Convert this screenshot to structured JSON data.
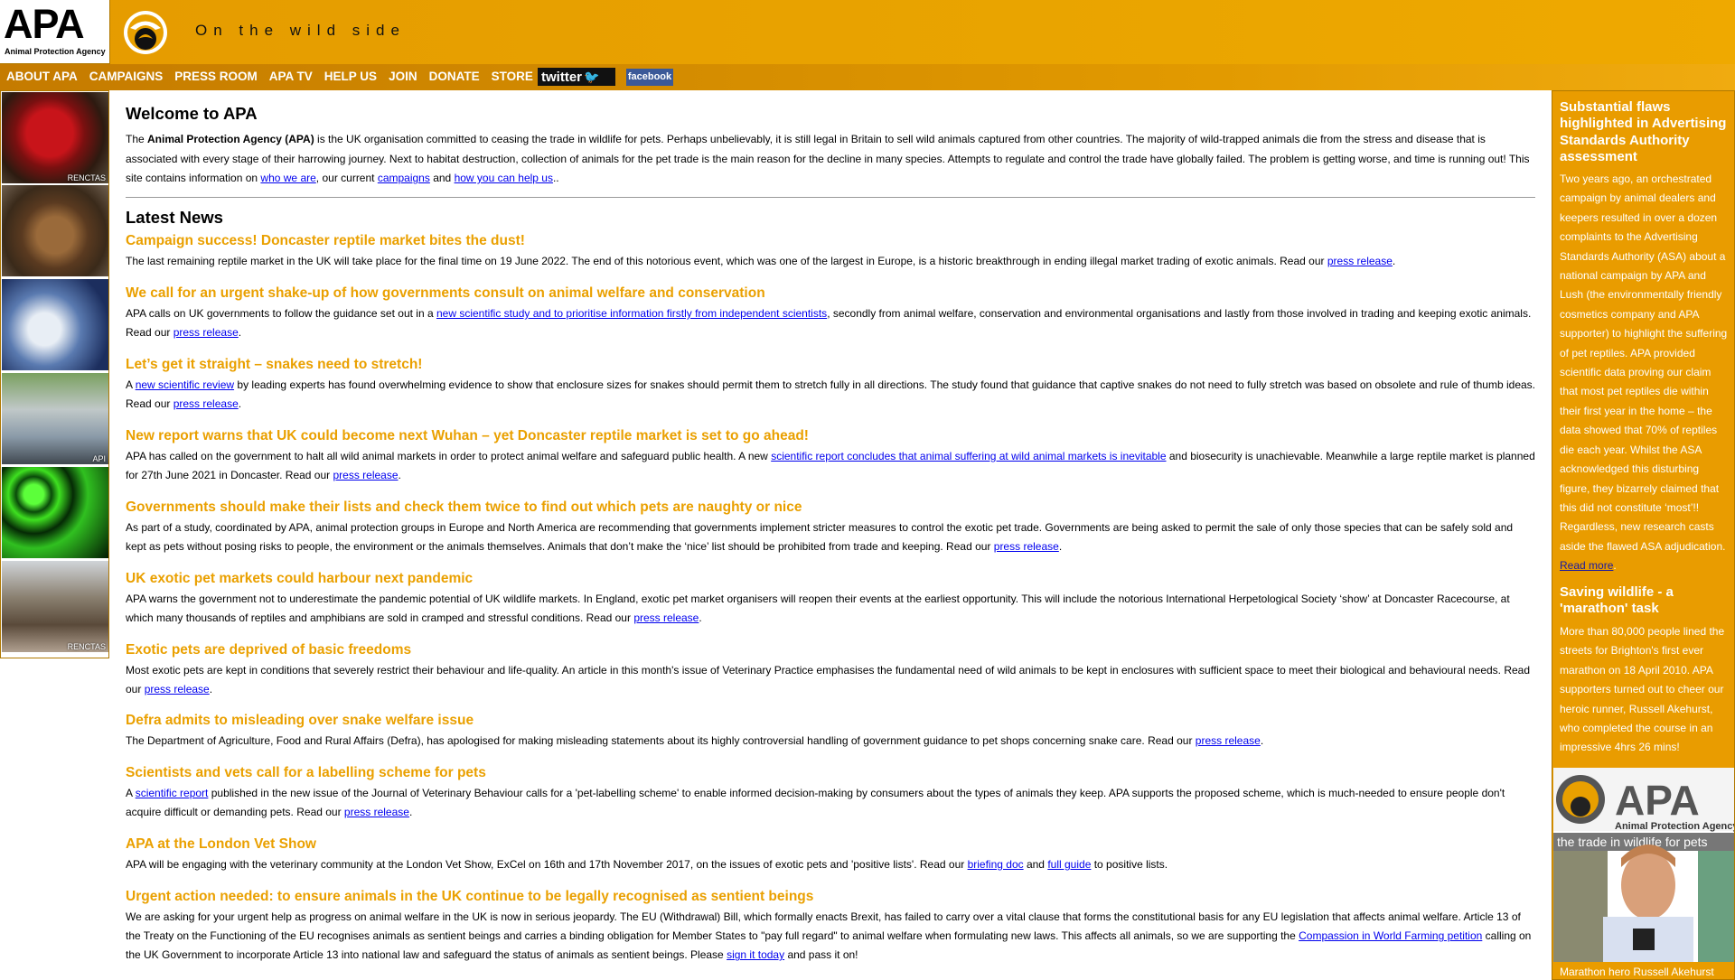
{
  "header": {
    "logo_text": "APA",
    "logo_subtext": "Animal Protection Agency",
    "tagline": "On the wild side"
  },
  "nav": {
    "items": [
      "ABOUT APA",
      "CAMPAIGNS",
      "PRESS ROOM",
      "APA TV",
      "HELP US",
      "JOIN",
      "DONATE",
      "STORE"
    ],
    "twitter": "twitter",
    "facebook": "facebook"
  },
  "left_strip": {
    "tags": [
      "RENCTAS",
      "API",
      "RENCTAS"
    ]
  },
  "welcome": {
    "title": "Welcome to APA",
    "intro_before": "The ",
    "intro_org": "Animal Protection Agency (APA)",
    "intro_middle": " is the UK organisation committed to ceasing the trade in wildlife for pets. Perhaps unbelievably, it is still legal in Britain to sell wild animals captured from other countries. The majority of wild-trapped animals die from the stress and disease that is associated with every stage of their harrowing journey. Next to habitat destruction, collection of animals for the pet trade is the main reason for the decline in many species. Attempts to regulate and control the trade have globally failed. The problem is getting worse, and time is running out! This site contains information on ",
    "link_who": "who we are",
    "sep1": ", our current ",
    "link_campaigns": "campaigns",
    "sep2": " and ",
    "link_help": "how you can help us",
    "intro_end": ".."
  },
  "latest": {
    "title": "Latest News",
    "press_release": "press release",
    "items": [
      {
        "title": "Campaign success! Doncaster reptile market bites the dust!",
        "text_before": "The last remaining reptile market in the UK will take place for the final time on 19 June 2022. The end of this notorious event, which was one of the largest in Europe, is a historic breakthrough in ending illegal market trading of exotic animals. Read our ",
        "end": "."
      },
      {
        "title": "We call for an urgent shake-up of how governments consult on animal welfare and conservation",
        "text_before": "APA calls on UK governments to follow the guidance set out in a ",
        "link": "new scientific study and to prioritise information firstly from independent scientists",
        "text_after": ", secondly from animal welfare, conservation and environmental organisations and lastly from those involved in trading and keeping exotic animals. Read our ",
        "end": "."
      },
      {
        "title": "Let’s get it straight – snakes need to stretch!",
        "text_before": "A ",
        "link": "new scientific review",
        "text_after": " by leading experts has found overwhelming evidence to show that enclosure sizes for snakes should permit them to stretch fully in all directions. The study found that guidance that captive snakes do not need to fully stretch was based on obsolete and rule of thumb ideas. Read our ",
        "end": "."
      },
      {
        "title": "New report warns that UK could become next Wuhan – yet Doncaster reptile market is set to go ahead!",
        "text_before": "APA has called on the government to halt all wild animal markets in order to protect animal welfare and safeguard public health. A new ",
        "link": "scientific report concludes that animal suffering at wild animal markets is inevitable",
        "text_after": " and biosecurity is unachievable. Meanwhile a large reptile market is planned for 27th June 2021 in Doncaster. Read our ",
        "end": "."
      },
      {
        "title": "Governments should make their lists and check them twice to find out which pets are naughty or nice",
        "text_before": "As part of a study, coordinated by APA, animal protection groups in Europe and North America are recommending that governments implement stricter measures to control the exotic pet trade. Governments are being asked to permit the sale of only those species that can be safely sold and kept as pets without posing risks to people, the environment or the animals themselves. Animals that don’t make the ‘nice’ list should be prohibited from trade and keeping. Read our ",
        "end": "."
      },
      {
        "title": "UK exotic pet markets could harbour next pandemic",
        "text_before": "APA warns the government not to underestimate the pandemic potential of UK wildlife markets. In England, exotic pet market organisers will reopen their events at the earliest opportunity. This will include the notorious International Herpetological Society ‘show’ at Doncaster Racecourse, at which many thousands of reptiles and amphibians are sold in cramped and stressful conditions. Read our ",
        "end": "."
      },
      {
        "title": "Exotic pets are deprived of basic freedoms",
        "text_before": "Most exotic pets are kept in conditions that severely restrict their behaviour and life-quality. An article in this month's issue of Veterinary Practice emphasises the fundamental need of wild animals to be kept in enclosures with sufficient space to meet their biological and behavioural needs. Read our ",
        "end": "."
      },
      {
        "title": "Defra admits to misleading over snake welfare issue",
        "text_before": "The Department of Agriculture, Food and Rural Affairs (Defra), has apologised for making misleading statements about its highly controversial handling of government guidance to pet shops concerning snake care. Read our ",
        "end": "."
      },
      {
        "title": "Scientists and vets call for a labelling scheme for pets",
        "text_before": "A ",
        "link": "scientific report",
        "text_after": " published in the new issue of the Journal of Veterinary Behaviour calls for a 'pet-labelling scheme' to enable informed decision-making by consumers about the types of animals they keep. APA supports the proposed scheme, which is much-needed to ensure people don't acquire difficult or demanding pets. Read our ",
        "end": "."
      }
    ],
    "vet_show": {
      "title": "APA at the London Vet Show",
      "text_before": "APA will be engaging with the veterinary community at the London Vet Show, ExCel on 16th and 17th November 2017, on the issues of exotic pets and 'positive lists'. Read our ",
      "link1": "briefing doc",
      "mid": " and ",
      "link2": "full guide",
      "end": " to positive lists."
    },
    "sentient": {
      "title": "Urgent action needed: to ensure animals in the UK continue to be legally recognised as sentient beings",
      "text_before": "We are asking for your urgent help as progress on animal welfare in the UK is now in serious jeopardy. The EU (Withdrawal) Bill, which formally enacts Brexit, has failed to carry over a vital clause that forms the constitutional basis for any EU legislation that affects animal welfare. Article 13 of the Treaty on the Functioning of the EU recognises animals as sentient beings and carries a binding obligation for Member States to \"pay full regard\" to animal welfare when formulating new laws. This affects all animals, so we are supporting the ",
      "link1": "Compassion in World Farming petition",
      "mid": " calling on the UK Government to incorporate Article 13 into national law and safeguard the status of animals as sentient beings. Please ",
      "link2": "sign it today",
      "end": " and pass it on!"
    }
  },
  "sidebar": {
    "asa_title": "Substantial flaws highlighted in Advertising Standards Authority assessment",
    "asa_body": "Two years ago, an orchestrated campaign by animal dealers and keepers resulted in over a dozen complaints to the Advertising Standards Authority (ASA) about a national campaign by APA and Lush (the environmentally friendly cosmetics company and APA supporter) to highlight the suffering of pet reptiles. APA provided scientific data proving our claim that most pet reptiles die within their first year in the home – the data showed that 70% of reptiles die each year. Whilst the ASA acknowledged this disturbing figure, they bizarrely claimed that this did not constitute ‘most’!! Regardless, new research casts aside the flawed ASA adjudication.",
    "read_more": "Read more",
    "read_more_end": ".",
    "marathon_title": "Saving wildlife - a 'marathon' task",
    "marathon_body": "More than 80,000 people lined the streets for Brighton's first ever marathon on 18 April 2010. APA supporters turned out to cheer our heroic runner, Russell Akehurst, who completed the course in an impressive 4hrs 26 mins!",
    "photo_logo": "APA",
    "photo_banner_1": "Animal Protection Agency",
    "photo_banner_2": "the trade in wildlife for pets",
    "photo_caption": "Marathon hero Russell Akehurst"
  },
  "colors": {
    "header_orange": "#e9a000",
    "headline_orange": "#eaa000",
    "link_blue": "#0000ee",
    "facebook_blue": "#3b5998"
  }
}
